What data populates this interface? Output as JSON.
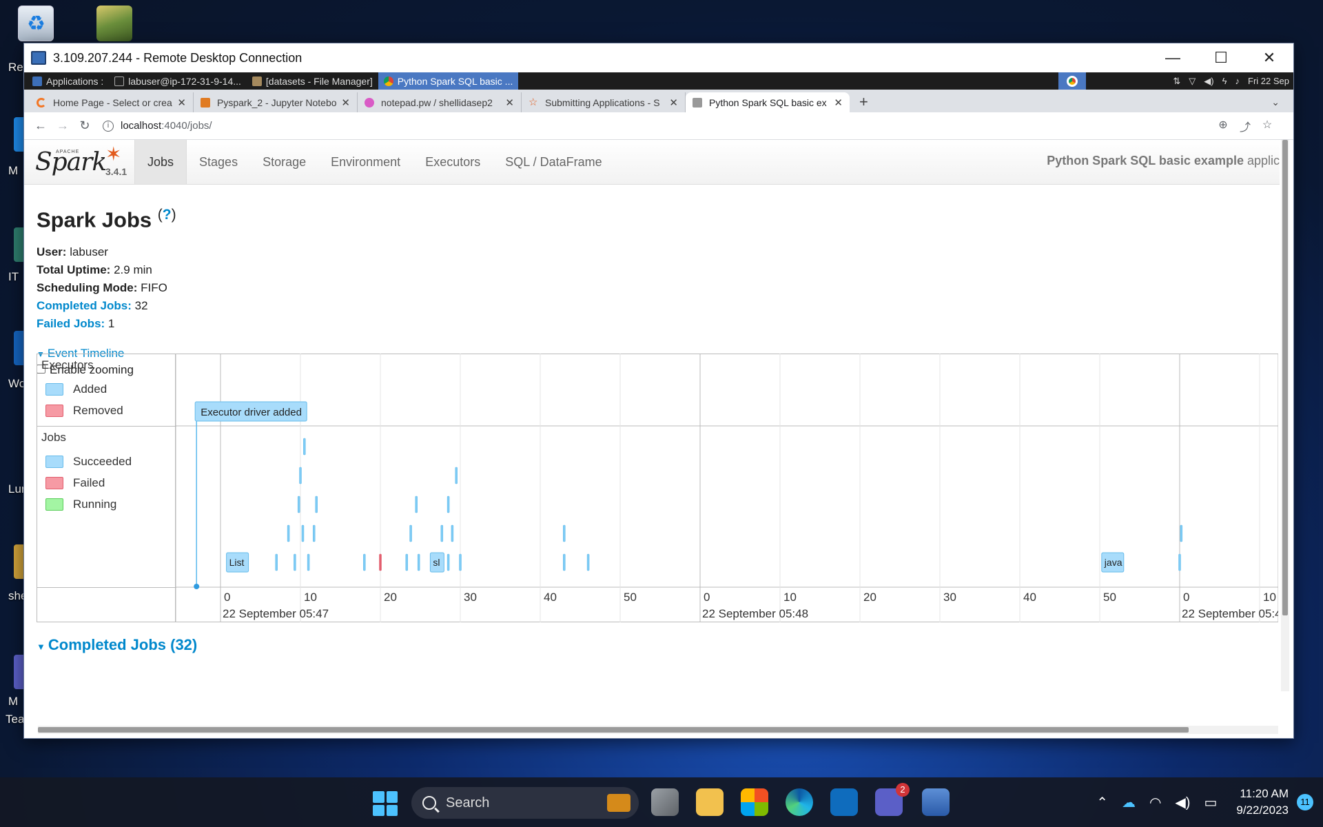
{
  "desktop": {
    "icons": [
      {
        "label": "Re"
      },
      {
        "label": "M"
      },
      {
        "label": "IT"
      },
      {
        "label": "Wo"
      },
      {
        "label": "Lun"
      },
      {
        "label": "shel"
      },
      {
        "label": "M"
      },
      {
        "label": "Tea"
      }
    ]
  },
  "rdp": {
    "title": "3.109.207.244 - Remote Desktop Connection",
    "minimize": "—",
    "maximize": "☐",
    "close": "✕"
  },
  "xfce": {
    "applications": "Applications :",
    "items": [
      "labuser@ip-172-31-9-14...",
      "[datasets - File Manager]",
      "Python Spark SQL basic ..."
    ],
    "clock": "Fri 22 Sep"
  },
  "browser": {
    "tabs": [
      {
        "title": "Home Page - Select or crea",
        "color": "#f37726"
      },
      {
        "title": "Pyspark_2 - Jupyter Notebo",
        "color": "#e07b22"
      },
      {
        "title": "notepad.pw / shellidasep2",
        "color": "#d95bc6"
      },
      {
        "title": "Submitting Applications - S",
        "color": "#e25a1c"
      },
      {
        "title": "Python Spark SQL basic ex",
        "color": "#777777"
      }
    ],
    "new_tab": "+",
    "url_host": "localhost",
    "url_path": ":4040/jobs/"
  },
  "spark": {
    "version": "3.4.1",
    "logo_word": "Spark",
    "logo_apache": "APACHE",
    "nav": [
      "Jobs",
      "Stages",
      "Storage",
      "Environment",
      "Executors",
      "SQL / DataFrame"
    ],
    "app_name": "Python Spark SQL basic example",
    "app_name_tail": " applic",
    "title": "Spark Jobs",
    "help": "?",
    "stats": {
      "user_label": "User:",
      "user": "labuser",
      "uptime_label": "Total Uptime:",
      "uptime": "2.9 min",
      "mode_label": "Scheduling Mode:",
      "mode": "FIFO",
      "completed_label": "Completed Jobs:",
      "completed": "32",
      "failed_label": "Failed Jobs:",
      "failed": "1"
    },
    "event_timeline": "Event Timeline",
    "enable_zooming": "Enable zooming",
    "legend": {
      "executors": "Executors",
      "added": "Added",
      "removed": "Removed",
      "jobs": "Jobs",
      "succeeded": "Succeeded",
      "failed": "Failed",
      "running": "Running"
    },
    "completed_jobs_heading": "Completed Jobs (32)"
  },
  "timeline": {
    "executor_label": "Executor driver added",
    "job_labels": [
      "List",
      "sl",
      "java"
    ],
    "seconds_ticks": [
      "0",
      "10",
      "20",
      "30",
      "40",
      "50",
      "0",
      "10",
      "20",
      "30",
      "40",
      "50",
      "0",
      "10"
    ],
    "minute_labels": [
      "22 September 05:47",
      "22 September 05:48",
      "22 September 05:4"
    ],
    "succeeded_color": "#a8dcfb",
    "failed_color": "#e25c6c"
  },
  "chart_data": {
    "type": "timeline",
    "minute_axis": [
      "22 September 05:47",
      "22 September 05:48",
      "22 September 05:4"
    ],
    "executor_events": [
      {
        "label": "Executor driver added",
        "status": "added",
        "time_s": -3
      }
    ],
    "jobs": [
      {
        "row": 0,
        "t": 10.5,
        "status": "succeeded"
      },
      {
        "row": 1,
        "t": 10,
        "status": "succeeded"
      },
      {
        "row": 1,
        "t": 29.5,
        "status": "succeeded"
      },
      {
        "row": 2,
        "t": 9.8,
        "status": "succeeded"
      },
      {
        "row": 2,
        "t": 12,
        "status": "succeeded"
      },
      {
        "row": 2,
        "t": 24.5,
        "status": "succeeded"
      },
      {
        "row": 2,
        "t": 28.5,
        "status": "succeeded"
      },
      {
        "row": 3,
        "t": 8.5,
        "status": "succeeded"
      },
      {
        "row": 3,
        "t": 10.3,
        "status": "succeeded"
      },
      {
        "row": 3,
        "t": 11.7,
        "status": "succeeded"
      },
      {
        "row": 3,
        "t": 23.8,
        "status": "succeeded"
      },
      {
        "row": 3,
        "t": 27.7,
        "status": "succeeded"
      },
      {
        "row": 3,
        "t": 29,
        "status": "succeeded"
      },
      {
        "row": 3,
        "t": 43,
        "status": "succeeded"
      },
      {
        "row": 3,
        "t": 120.2,
        "status": "succeeded"
      },
      {
        "row": 4,
        "t": 1,
        "status": "succeeded",
        "label": "List"
      },
      {
        "row": 4,
        "t": 7,
        "status": "succeeded"
      },
      {
        "row": 4,
        "t": 9.3,
        "status": "succeeded"
      },
      {
        "row": 4,
        "t": 11,
        "status": "succeeded"
      },
      {
        "row": 4,
        "t": 18,
        "status": "succeeded"
      },
      {
        "row": 4,
        "t": 20,
        "status": "failed"
      },
      {
        "row": 4,
        "t": 23.3,
        "status": "succeeded"
      },
      {
        "row": 4,
        "t": 24.8,
        "status": "succeeded"
      },
      {
        "row": 4,
        "t": 26.5,
        "status": "succeeded",
        "label": "sl"
      },
      {
        "row": 4,
        "t": 28.5,
        "status": "succeeded"
      },
      {
        "row": 4,
        "t": 30,
        "status": "succeeded"
      },
      {
        "row": 4,
        "t": 43,
        "status": "succeeded"
      },
      {
        "row": 4,
        "t": 46,
        "status": "succeeded"
      },
      {
        "row": 4,
        "t": 110.5,
        "status": "succeeded",
        "label": "java"
      },
      {
        "row": 4,
        "t": 120,
        "status": "succeeded"
      }
    ]
  },
  "taskbar": {
    "search": "Search",
    "teams_badge": "2",
    "time": "11:20 AM",
    "date": "9/22/2023",
    "notifications": "11"
  }
}
